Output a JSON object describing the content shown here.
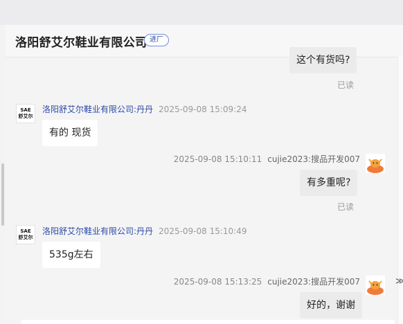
{
  "header": {
    "company": "洛阳舒艾尔鞋业有限公司",
    "badge": "进厂"
  },
  "avatars": {
    "supplier_line1": "SAE",
    "supplier_line2": "舒艾尔"
  },
  "messages": [
    {
      "side": "right",
      "text": "这个有货吗?",
      "status": "已读"
    },
    {
      "side": "left",
      "sender": "洛阳舒艾尔鞋业有限公司:丹丹",
      "time": "2025-09-08 15:09:24",
      "text": "有的 现货"
    },
    {
      "side": "right",
      "sender": "cujie2023:搜品开发007",
      "time": "2025-09-08 15:10:11",
      "text": "有多重呢?",
      "status": "已读"
    },
    {
      "side": "left",
      "sender": "洛阳舒艾尔鞋业有限公司:丹丹",
      "time": "2025-09-08 15:10:49",
      "text": "535g左右"
    },
    {
      "side": "right",
      "sender": "cujie2023:搜品开发007",
      "time": "2025-09-08 15:13:25",
      "text": "好的，谢谢"
    }
  ],
  "expand_icon": "double-chevron-right-icon",
  "colors": {
    "link_blue": "#2b4aa8",
    "panel_bg": "#f4f4f4",
    "bubble_right": "#ebebeb"
  }
}
